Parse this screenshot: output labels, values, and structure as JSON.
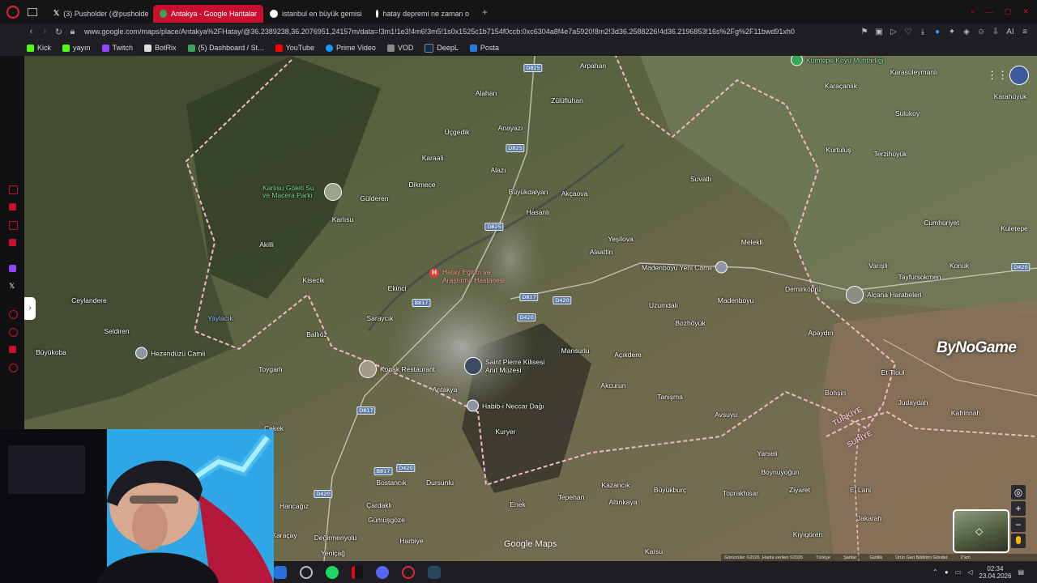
{
  "browser": {
    "tabs": [
      {
        "title": "(3) Pusholder (@pusholde",
        "active": false,
        "icon": "x-logo-icon"
      },
      {
        "title": "Antakya - Google Haritalar",
        "active": true,
        "icon": "google-maps-icon"
      },
      {
        "title": "istanbul en büyük gemisi",
        "active": false,
        "icon": "google-icon"
      },
      {
        "title": "hatay depremi ne zaman o",
        "active": false,
        "icon": "google-icon"
      }
    ],
    "new_tab_label": "+",
    "url": "www.google.com/maps/place/Antakya%2FHatay/@36.2389238,36.2076951,24157m/data=!3m1!1e3!4m6!3m5!1s0x1525c1b7154f0ccb:0xc6304a8f4e7a5920!8m2!3d36.2588226!4d36.2196853!16s%2Fg%2F11bwd91xh0",
    "ai_label": "AI"
  },
  "bookmarks": [
    {
      "label": "Kick",
      "color": "#53fc18"
    },
    {
      "label": "yayın",
      "color": "#53fc18"
    },
    {
      "label": "Twitch",
      "color": "#9146ff"
    },
    {
      "label": "BotRix",
      "color": "#dddddd"
    },
    {
      "label": "(5) Dashboard / St...",
      "color": "#3ba55d"
    },
    {
      "label": "YouTube",
      "color": "#ff0000"
    },
    {
      "label": "Prime Video",
      "color": "#1399ff"
    },
    {
      "label": "VOD",
      "color": "#8a8a8a"
    },
    {
      "label": "DeepL",
      "color": "#0f2b46"
    },
    {
      "label": "Posta",
      "color": "#2b7bd8"
    }
  ],
  "map": {
    "places": [
      {
        "name": "Arpahan"
      },
      {
        "name": "Alahan"
      },
      {
        "name": "Zülüfluhan"
      },
      {
        "name": "Üçgedik"
      },
      {
        "name": "Anayazı"
      },
      {
        "name": "Karaali"
      },
      {
        "name": "Dikmece"
      },
      {
        "name": "Alazı"
      },
      {
        "name": "Büyükdalyan"
      },
      {
        "name": "Akçaova"
      },
      {
        "name": "Gülderen"
      },
      {
        "name": "Hasanlı"
      },
      {
        "name": "Karlısu"
      },
      {
        "name": "Suvatlı"
      },
      {
        "name": "Akilli"
      },
      {
        "name": "Yeşilova"
      },
      {
        "name": "Alaattin"
      },
      {
        "name": "Melekli"
      },
      {
        "name": "Kisecik"
      },
      {
        "name": "Ekinci"
      },
      {
        "name": "Ceylandere"
      },
      {
        "name": "Saraycık"
      },
      {
        "name": "Uzumdalı"
      },
      {
        "name": "Madenboyu"
      },
      {
        "name": "Demirköprü"
      },
      {
        "name": "Bozhöyük"
      },
      {
        "name": "Seldiren"
      },
      {
        "name": "Ballıöz"
      },
      {
        "name": "Apaydın"
      },
      {
        "name": "Büyükoba"
      },
      {
        "name": "Mansurlu"
      },
      {
        "name": "Açıkdere"
      },
      {
        "name": "Toygarlı"
      },
      {
        "name": "Antakya"
      },
      {
        "name": "Akcurun"
      },
      {
        "name": "Tanişma"
      },
      {
        "name": "Kuryer"
      },
      {
        "name": "Avsuyu"
      },
      {
        "name": "Bohşin"
      },
      {
        "name": "Judaydah"
      },
      {
        "name": "Kafrinnah"
      },
      {
        "name": "Et Tloul"
      },
      {
        "name": "Cekek"
      },
      {
        "name": "Yarseli"
      },
      {
        "name": "Boynuyoğun"
      },
      {
        "name": "Büyükburç"
      },
      {
        "name": "Kazancık"
      },
      {
        "name": "Bostancık"
      },
      {
        "name": "Dursunlu"
      },
      {
        "name": "Hancağız"
      },
      {
        "name": "Çardaklı"
      },
      {
        "name": "Gümüşgöze"
      },
      {
        "name": "Enek"
      },
      {
        "name": "Tepehan"
      },
      {
        "name": "Altınkaya"
      },
      {
        "name": "Toprakhisar"
      },
      {
        "name": "Ziyaret"
      },
      {
        "name": "El Lani"
      },
      {
        "name": "Jakarah"
      },
      {
        "name": "Kıyıgören"
      },
      {
        "name": "Karaçay"
      },
      {
        "name": "Değirmenyolu"
      },
      {
        "name": "Harbiye"
      },
      {
        "name": "Yeniçağ"
      },
      {
        "name": "Karsu"
      },
      {
        "name": "Kuletepe"
      },
      {
        "name": "Cumhuriyet"
      },
      {
        "name": "Terzihüyük"
      },
      {
        "name": "Kurtuluş"
      },
      {
        "name": "Sulukoy"
      },
      {
        "name": "Karaçanlık"
      },
      {
        "name": "Karasüleymanlı"
      },
      {
        "name": "Karahüyük"
      },
      {
        "name": "Varışlı"
      },
      {
        "name": "Tayfursokmen"
      },
      {
        "name": "Konuk"
      },
      {
        "name": "Yaylacık"
      }
    ],
    "pois": [
      {
        "name": "Karlısu Göleti Su ve Macera Parkı",
        "icon": "park-photo-icon"
      },
      {
        "name": "Madenboyu Yeni Camii",
        "icon": "mosque-icon"
      },
      {
        "name": "Alçana Harabeleri",
        "icon": "ruins-photo-icon"
      },
      {
        "name": "Hezendüzü Camii",
        "icon": "mosque-icon"
      },
      {
        "name": "Konak Restaurant",
        "icon": "restaurant-photo-icon"
      },
      {
        "name": "Saint Pierre Kilisesi Anıt Müzesi",
        "icon": "museum-photo-icon"
      },
      {
        "name": "Habib-i Neccar Dağı",
        "icon": "mountain-icon"
      },
      {
        "name": "Kumtepe Köyü Muhtarlığı",
        "icon": "government-icon"
      }
    ],
    "hospital": {
      "line1": "Hatay Eğitim ve",
      "line2": "Araştırma Hastanesi"
    },
    "roads": [
      "D825",
      "D825",
      "D825",
      "D420",
      "D420",
      "B817",
      "D817",
      "D817",
      "D420",
      "D420",
      "D420",
      "B817"
    ],
    "border_labels": {
      "turkey": "TÜRKİYE",
      "syria": "SURİYE"
    },
    "watermark": "ByNoGame",
    "logo": "Google Maps",
    "footer": [
      "Görüntüler ©2026 ,Harita verileri ©2026",
      "Türkiye",
      "Şartlar",
      "Gizlilik",
      "Ürün Geri Bildirimi Gönder",
      "2 km"
    ]
  },
  "taskbar": {
    "time": "02:34",
    "date": "23.04.2026"
  }
}
